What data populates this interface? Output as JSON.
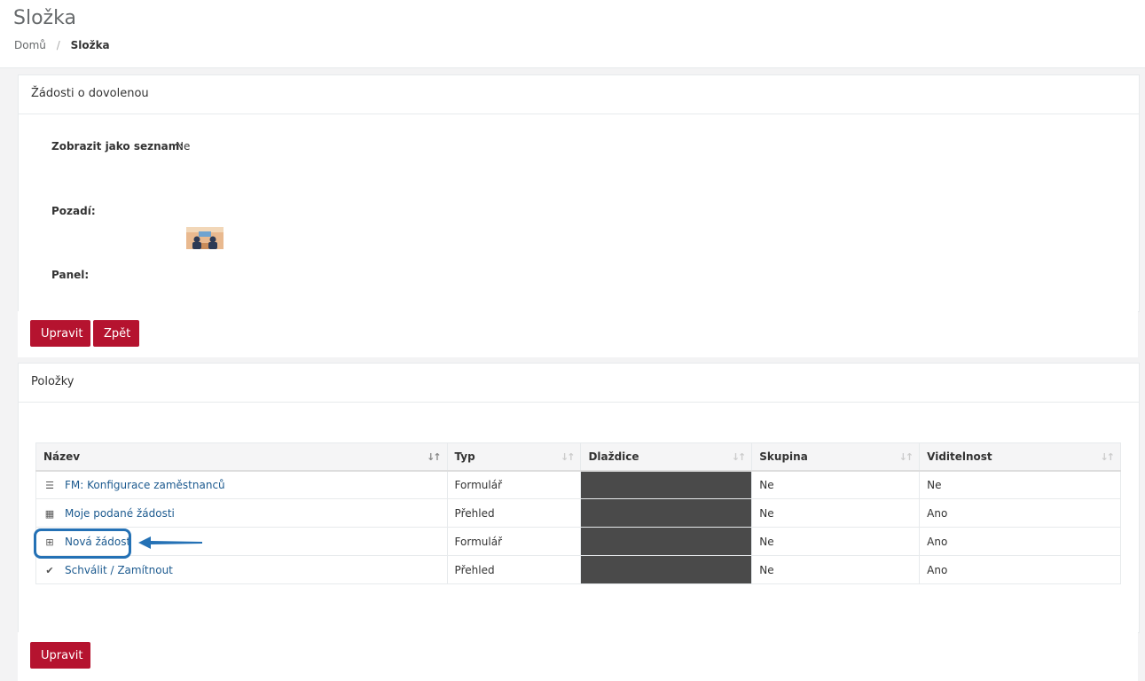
{
  "page": {
    "title": "Složka",
    "breadcrumb": {
      "home": "Domů",
      "separator": "/",
      "current": "Složka"
    }
  },
  "details": {
    "heading": "Žádosti o dovolenou",
    "fields": {
      "list_label": "Zobrazit jako seznam:",
      "list_value": "Ne",
      "background_label": "Pozadí:",
      "panel_label": "Panel:"
    },
    "buttons": {
      "edit": "Upravit",
      "back": "Zpět"
    }
  },
  "items": {
    "heading": "Položky",
    "columns": [
      "Název",
      "Typ",
      "Dlaždice",
      "Skupina",
      "Viditelnost"
    ],
    "rows": [
      {
        "icon": "list-icon",
        "glyph": "☰",
        "name": "FM: Konfigurace zaměstnanců",
        "type": "Formulář",
        "group": "Ne",
        "visibility": "Ne"
      },
      {
        "icon": "table-icon",
        "glyph": "▦",
        "name": "Moje podané žádosti",
        "type": "Přehled",
        "group": "Ne",
        "visibility": "Ano"
      },
      {
        "icon": "plus-square-icon",
        "glyph": "⊞",
        "name": "Nová žádost",
        "type": "Formulář",
        "group": "Ne",
        "visibility": "Ano"
      },
      {
        "icon": "check-circle-icon",
        "glyph": "✔",
        "name": "Schválit / Zamítnout",
        "type": "Přehled",
        "group": "Ne",
        "visibility": "Ano"
      }
    ],
    "edit_button": "Upravit"
  },
  "colors": {
    "primary_button": "#b5132f",
    "link": "#1c5a8f",
    "highlight": "#2471b5",
    "tile": "#4a4a4a"
  }
}
